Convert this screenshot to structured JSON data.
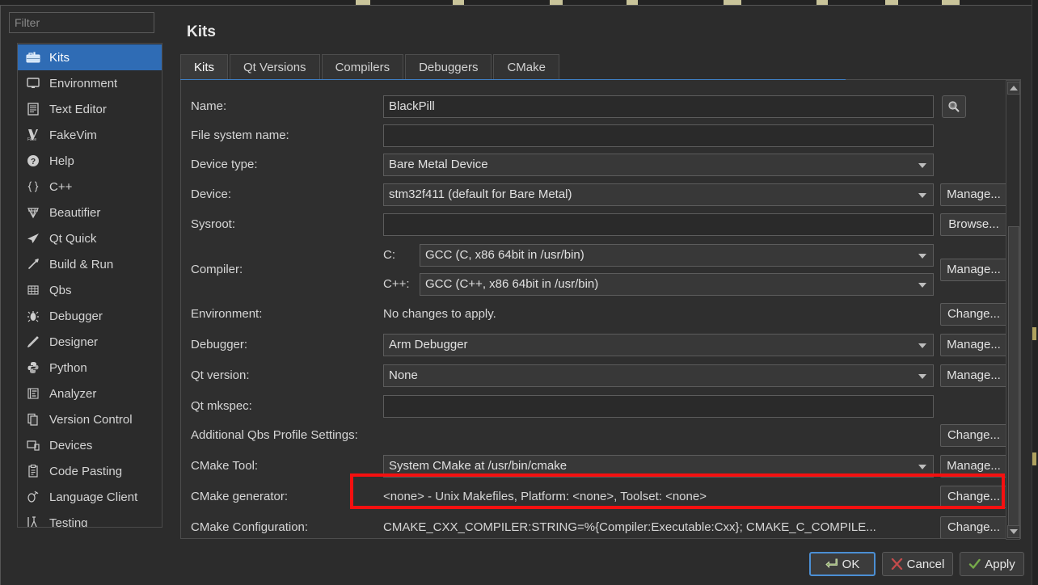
{
  "window": {
    "title": "Kits"
  },
  "sidebar": {
    "filter_placeholder": "Filter",
    "items": [
      {
        "label": "Kits",
        "icon": "kits-icon",
        "selected": true
      },
      {
        "label": "Environment",
        "icon": "monitor-icon",
        "selected": false
      },
      {
        "label": "Text Editor",
        "icon": "document-icon",
        "selected": false
      },
      {
        "label": "FakeVim",
        "icon": "fakevim-icon",
        "selected": false
      },
      {
        "label": "Help",
        "icon": "help-icon",
        "selected": false
      },
      {
        "label": "C++",
        "icon": "braces-icon",
        "selected": false
      },
      {
        "label": "Beautifier",
        "icon": "diamond-icon",
        "selected": false
      },
      {
        "label": "Qt Quick",
        "icon": "paperplane-icon",
        "selected": false
      },
      {
        "label": "Build & Run",
        "icon": "hammer-icon",
        "selected": false
      },
      {
        "label": "Qbs",
        "icon": "grid-icon",
        "selected": false
      },
      {
        "label": "Debugger",
        "icon": "bug-icon",
        "selected": false
      },
      {
        "label": "Designer",
        "icon": "pencil-icon",
        "selected": false
      },
      {
        "label": "Python",
        "icon": "python-icon",
        "selected": false
      },
      {
        "label": "Analyzer",
        "icon": "analyzer-icon",
        "selected": false
      },
      {
        "label": "Version Control",
        "icon": "copy-icon",
        "selected": false
      },
      {
        "label": "Devices",
        "icon": "devices-icon",
        "selected": false
      },
      {
        "label": "Code Pasting",
        "icon": "clipboard-icon",
        "selected": false
      },
      {
        "label": "Language Client",
        "icon": "plug-icon",
        "selected": false
      },
      {
        "label": "Testing",
        "icon": "flask-icon",
        "selected": false
      }
    ]
  },
  "tabs": [
    {
      "label": "Kits",
      "active": true
    },
    {
      "label": "Qt Versions",
      "active": false
    },
    {
      "label": "Compilers",
      "active": false
    },
    {
      "label": "Debuggers",
      "active": false
    },
    {
      "label": "CMake",
      "active": false
    }
  ],
  "form": {
    "name": {
      "label": "Name:",
      "value": "BlackPill"
    },
    "filesystem_name": {
      "label": "File system name:",
      "value": ""
    },
    "device_type": {
      "label": "Device type:",
      "value": "Bare Metal Device"
    },
    "device": {
      "label": "Device:",
      "value": "stm32f411 (default for Bare Metal)",
      "button": "Manage..."
    },
    "sysroot": {
      "label": "Sysroot:",
      "value": "",
      "button": "Browse..."
    },
    "compiler": {
      "label": "Compiler:",
      "c_label": "C:",
      "c_value": "GCC (C, x86 64bit in /usr/bin)",
      "cxx_label": "C++:",
      "cxx_value": "GCC (C++, x86 64bit in /usr/bin)",
      "button": "Manage..."
    },
    "environment": {
      "label": "Environment:",
      "value": "No changes to apply.",
      "button": "Change..."
    },
    "debugger": {
      "label": "Debugger:",
      "value": "Arm Debugger",
      "button": "Manage..."
    },
    "qt_version": {
      "label": "Qt version:",
      "value": "None",
      "button": "Manage..."
    },
    "qt_mkspec": {
      "label": "Qt mkspec:",
      "value": ""
    },
    "additional_qbs": {
      "label": "Additional Qbs Profile Settings:",
      "button": "Change..."
    },
    "cmake_tool": {
      "label": "CMake Tool:",
      "value": "System CMake at /usr/bin/cmake",
      "button": "Manage..."
    },
    "cmake_generator": {
      "label": "CMake generator:",
      "value": "<none> - Unix Makefiles, Platform: <none>, Toolset: <none>",
      "button": "Change...",
      "highlight_color": "#f51010"
    },
    "cmake_configuration": {
      "label": "CMake Configuration:",
      "value": "CMAKE_CXX_COMPILER:STRING=%{Compiler:Executable:Cxx}; CMAKE_C_COMPILE...",
      "button": "Change..."
    },
    "search_button_icon": "search-icon"
  },
  "footer": {
    "ok": "OK",
    "cancel": "Cancel",
    "apply": "Apply"
  },
  "colors": {
    "accent": "#2f6cb5",
    "tab_underline": "#3f7fc4",
    "highlight": "#f51010",
    "background": "#2c2c2c"
  }
}
